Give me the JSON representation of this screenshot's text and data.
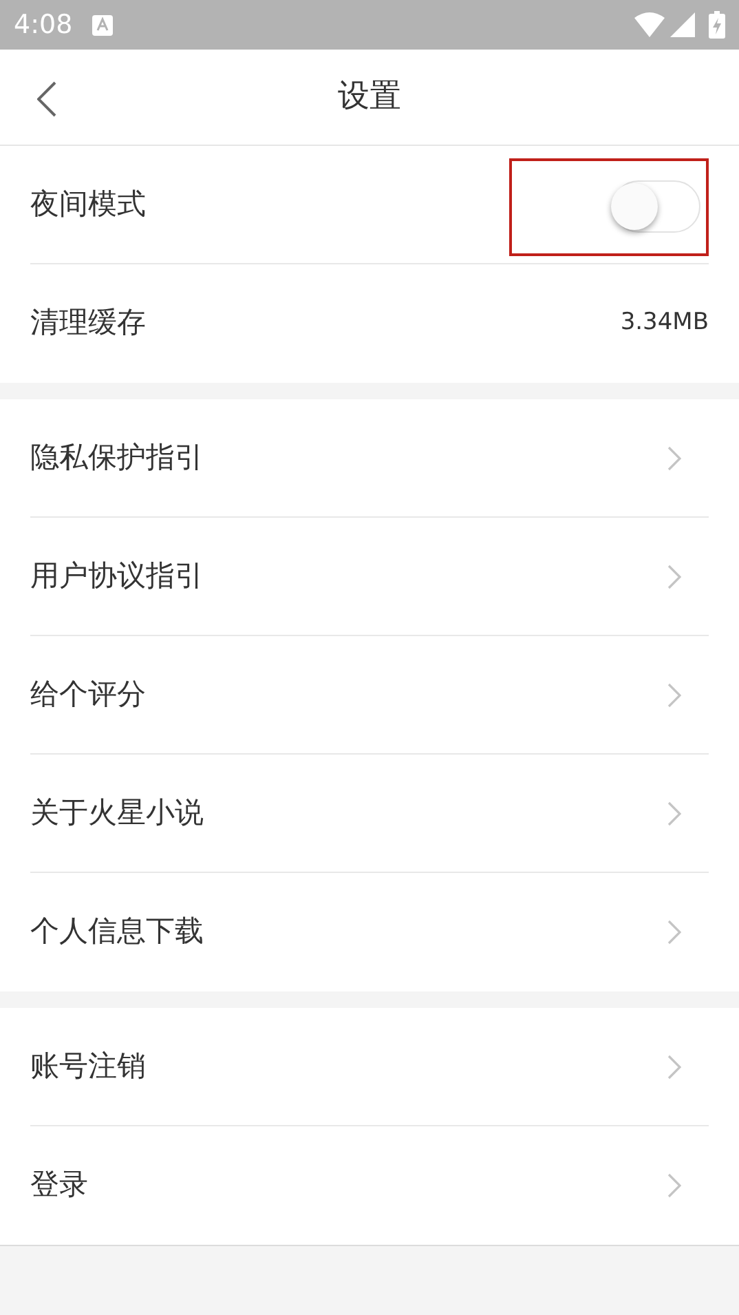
{
  "status_bar": {
    "time": "4:08"
  },
  "header": {
    "title": "设置"
  },
  "sections": [
    {
      "items": [
        {
          "kind": "switch",
          "label": "夜间模式",
          "on": false,
          "highlighted": true
        },
        {
          "kind": "value",
          "label": "清理缓存",
          "value": "3.34MB"
        }
      ]
    },
    {
      "items": [
        {
          "kind": "link",
          "label": "隐私保护指引"
        },
        {
          "kind": "link",
          "label": "用户协议指引"
        },
        {
          "kind": "link",
          "label": "给个评分"
        },
        {
          "kind": "link",
          "label": "关于火星小说"
        },
        {
          "kind": "link",
          "label": "个人信息下载"
        }
      ]
    },
    {
      "items": [
        {
          "kind": "link",
          "label": "账号注销"
        },
        {
          "kind": "link",
          "label": "登录"
        }
      ]
    }
  ]
}
